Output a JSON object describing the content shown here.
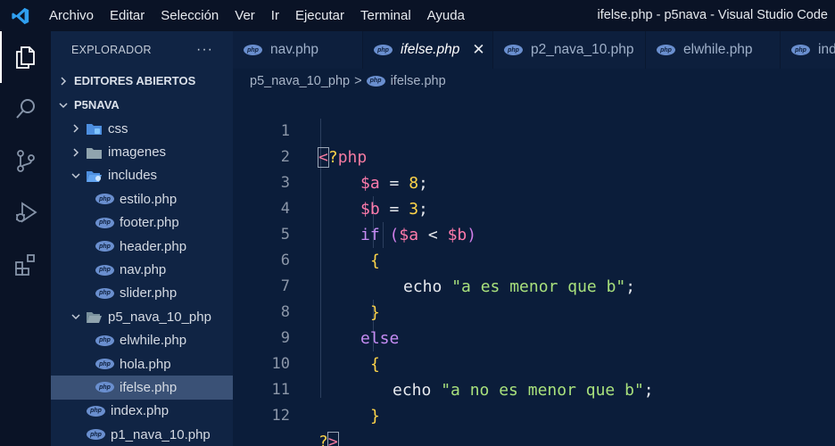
{
  "window": {
    "title": "ifelse.php - p5nava - Visual Studio Code"
  },
  "menu": [
    "Archivo",
    "Editar",
    "Selección",
    "Ver",
    "Ir",
    "Ejecutar",
    "Terminal",
    "Ayuda"
  ],
  "activity": [
    "explorer-icon",
    "search-icon",
    "source-control-icon",
    "run-debug-icon",
    "extensions-icon"
  ],
  "sidebar": {
    "title": "EXPLORADOR",
    "more": "···",
    "open_editors": "EDITORES ABIERTOS",
    "project": "P5NAVA",
    "tree": [
      {
        "label": "css",
        "type": "folder",
        "expanded": false,
        "level": 1
      },
      {
        "label": "imagenes",
        "type": "folder",
        "expanded": false,
        "level": 1
      },
      {
        "label": "includes",
        "type": "folder",
        "expanded": true,
        "level": 1
      },
      {
        "label": "estilo.php",
        "type": "php",
        "level": 2
      },
      {
        "label": "footer.php",
        "type": "php",
        "level": 2
      },
      {
        "label": "header.php",
        "type": "php",
        "level": 2
      },
      {
        "label": "nav.php",
        "type": "php",
        "level": 2
      },
      {
        "label": "slider.php",
        "type": "php",
        "level": 2
      },
      {
        "label": "p5_nava_10_php",
        "type": "folder",
        "expanded": true,
        "level": 1
      },
      {
        "label": "elwhile.php",
        "type": "php",
        "level": 2
      },
      {
        "label": "hola.php",
        "type": "php",
        "level": 2
      },
      {
        "label": "ifelse.php",
        "type": "php",
        "level": 2,
        "selected": true
      },
      {
        "label": "index.php",
        "type": "php",
        "level": 1
      },
      {
        "label": "p1_nava_10.php",
        "type": "php",
        "level": 1
      }
    ]
  },
  "tabs": [
    {
      "label": "nav.php",
      "active": false
    },
    {
      "label": "ifelse.php",
      "active": true,
      "close": "✕"
    },
    {
      "label": "p2_nava_10.php",
      "active": false
    },
    {
      "label": "elwhile.php",
      "active": false
    },
    {
      "label": "index.php",
      "active": false
    }
  ],
  "php_badge": "php",
  "breadcrumb": {
    "folder": "p5_nava_10_php",
    "sep": ">",
    "file": "ifelse.php"
  },
  "editor": {
    "line_numbers": [
      "1",
      "2",
      "3",
      "4",
      "5",
      "6",
      "7",
      "8",
      "9",
      "10",
      "11",
      "12"
    ],
    "tokens": {
      "open_lt": "<",
      "open_q": "?",
      "open_php": "php",
      "var_a": "$a",
      "var_b": "$b",
      "eq": " = ",
      "num_8": "8",
      "num_3": "3",
      "semi": ";",
      "kw_if": "if",
      "lparen": "(",
      "rparen": ")",
      "lt_op": " < ",
      "lbrace": "{",
      "rbrace": "}",
      "echo": "echo",
      "str_menor": "\"a es menor que b\"",
      "str_no_menor": "\"a no es menor que b\"",
      "kw_else": "else",
      "close_q": "?",
      "close_gt": ">"
    }
  },
  "colors": {
    "background": "#0b1d3a",
    "sidebar": "#102444",
    "activity_bar": "#0a1326",
    "selection": "#3a5176",
    "var": "#ff7bac",
    "keyword": "#c58cf3",
    "string": "#a8e07c",
    "number": "#ffd54a"
  }
}
